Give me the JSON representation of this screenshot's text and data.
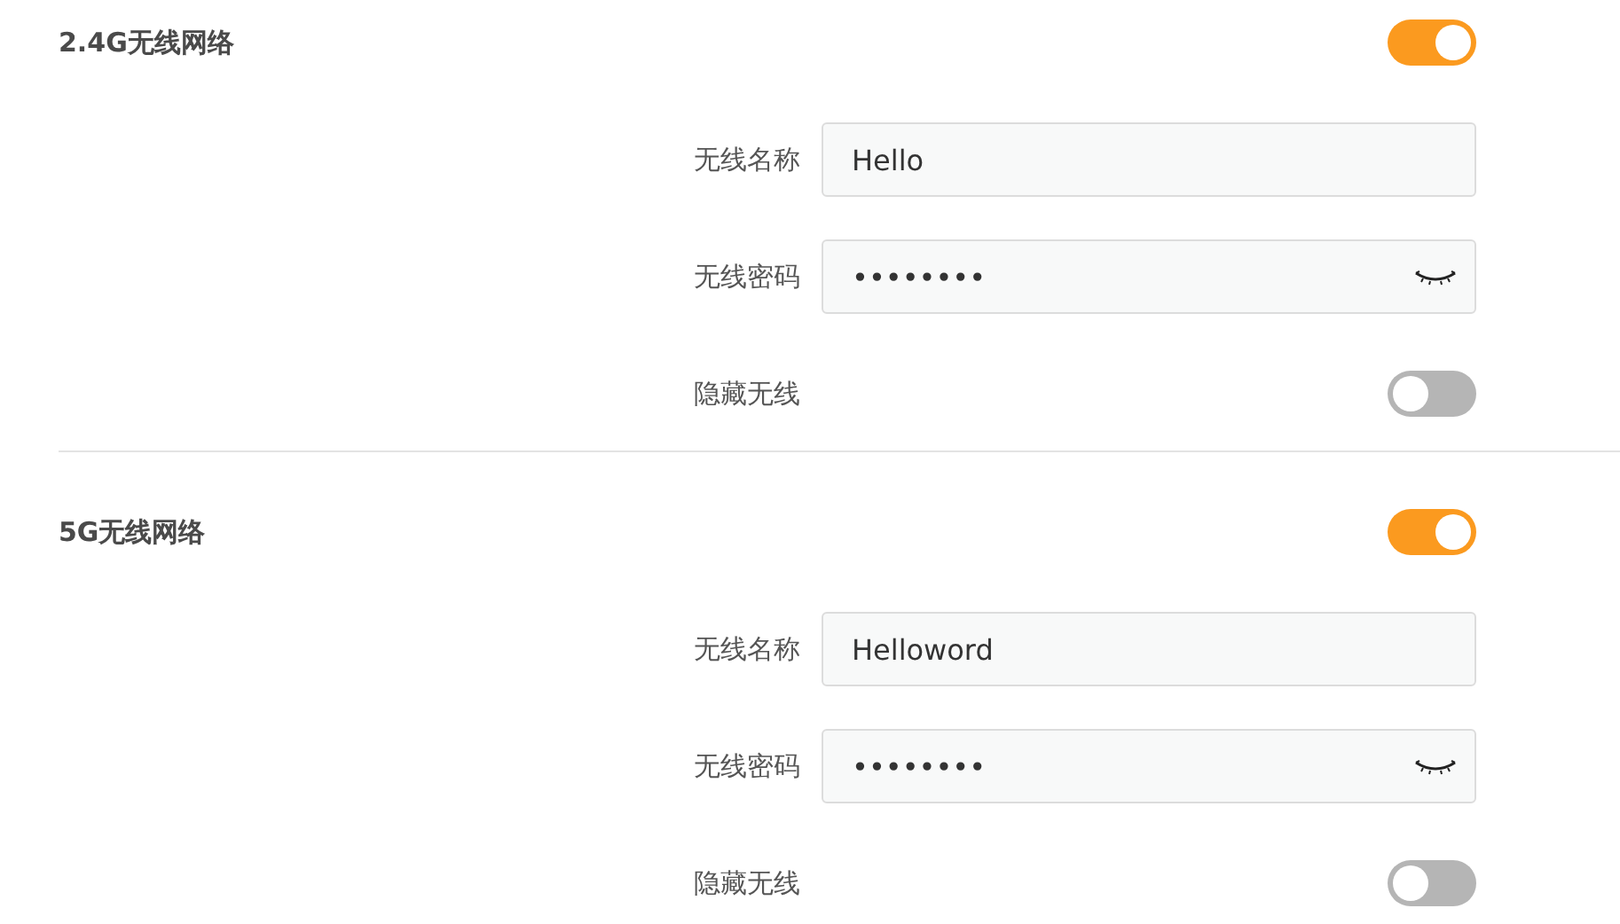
{
  "sections": [
    {
      "title": "2.4G无线网络",
      "enabled": true,
      "fields": [
        {
          "kind": "text",
          "label": "无线名称",
          "value": "Hello"
        },
        {
          "kind": "password",
          "label": "无线密码",
          "value": "••••••••"
        },
        {
          "kind": "toggle",
          "label": "隐藏无线",
          "on": false
        }
      ]
    },
    {
      "title": "5G无线网络",
      "enabled": true,
      "fields": [
        {
          "kind": "text",
          "label": "无线名称",
          "value": "Helloword"
        },
        {
          "kind": "password",
          "label": "无线密码",
          "value": "••••••••"
        },
        {
          "kind": "toggle",
          "label": "隐藏无线",
          "on": false
        }
      ]
    }
  ]
}
